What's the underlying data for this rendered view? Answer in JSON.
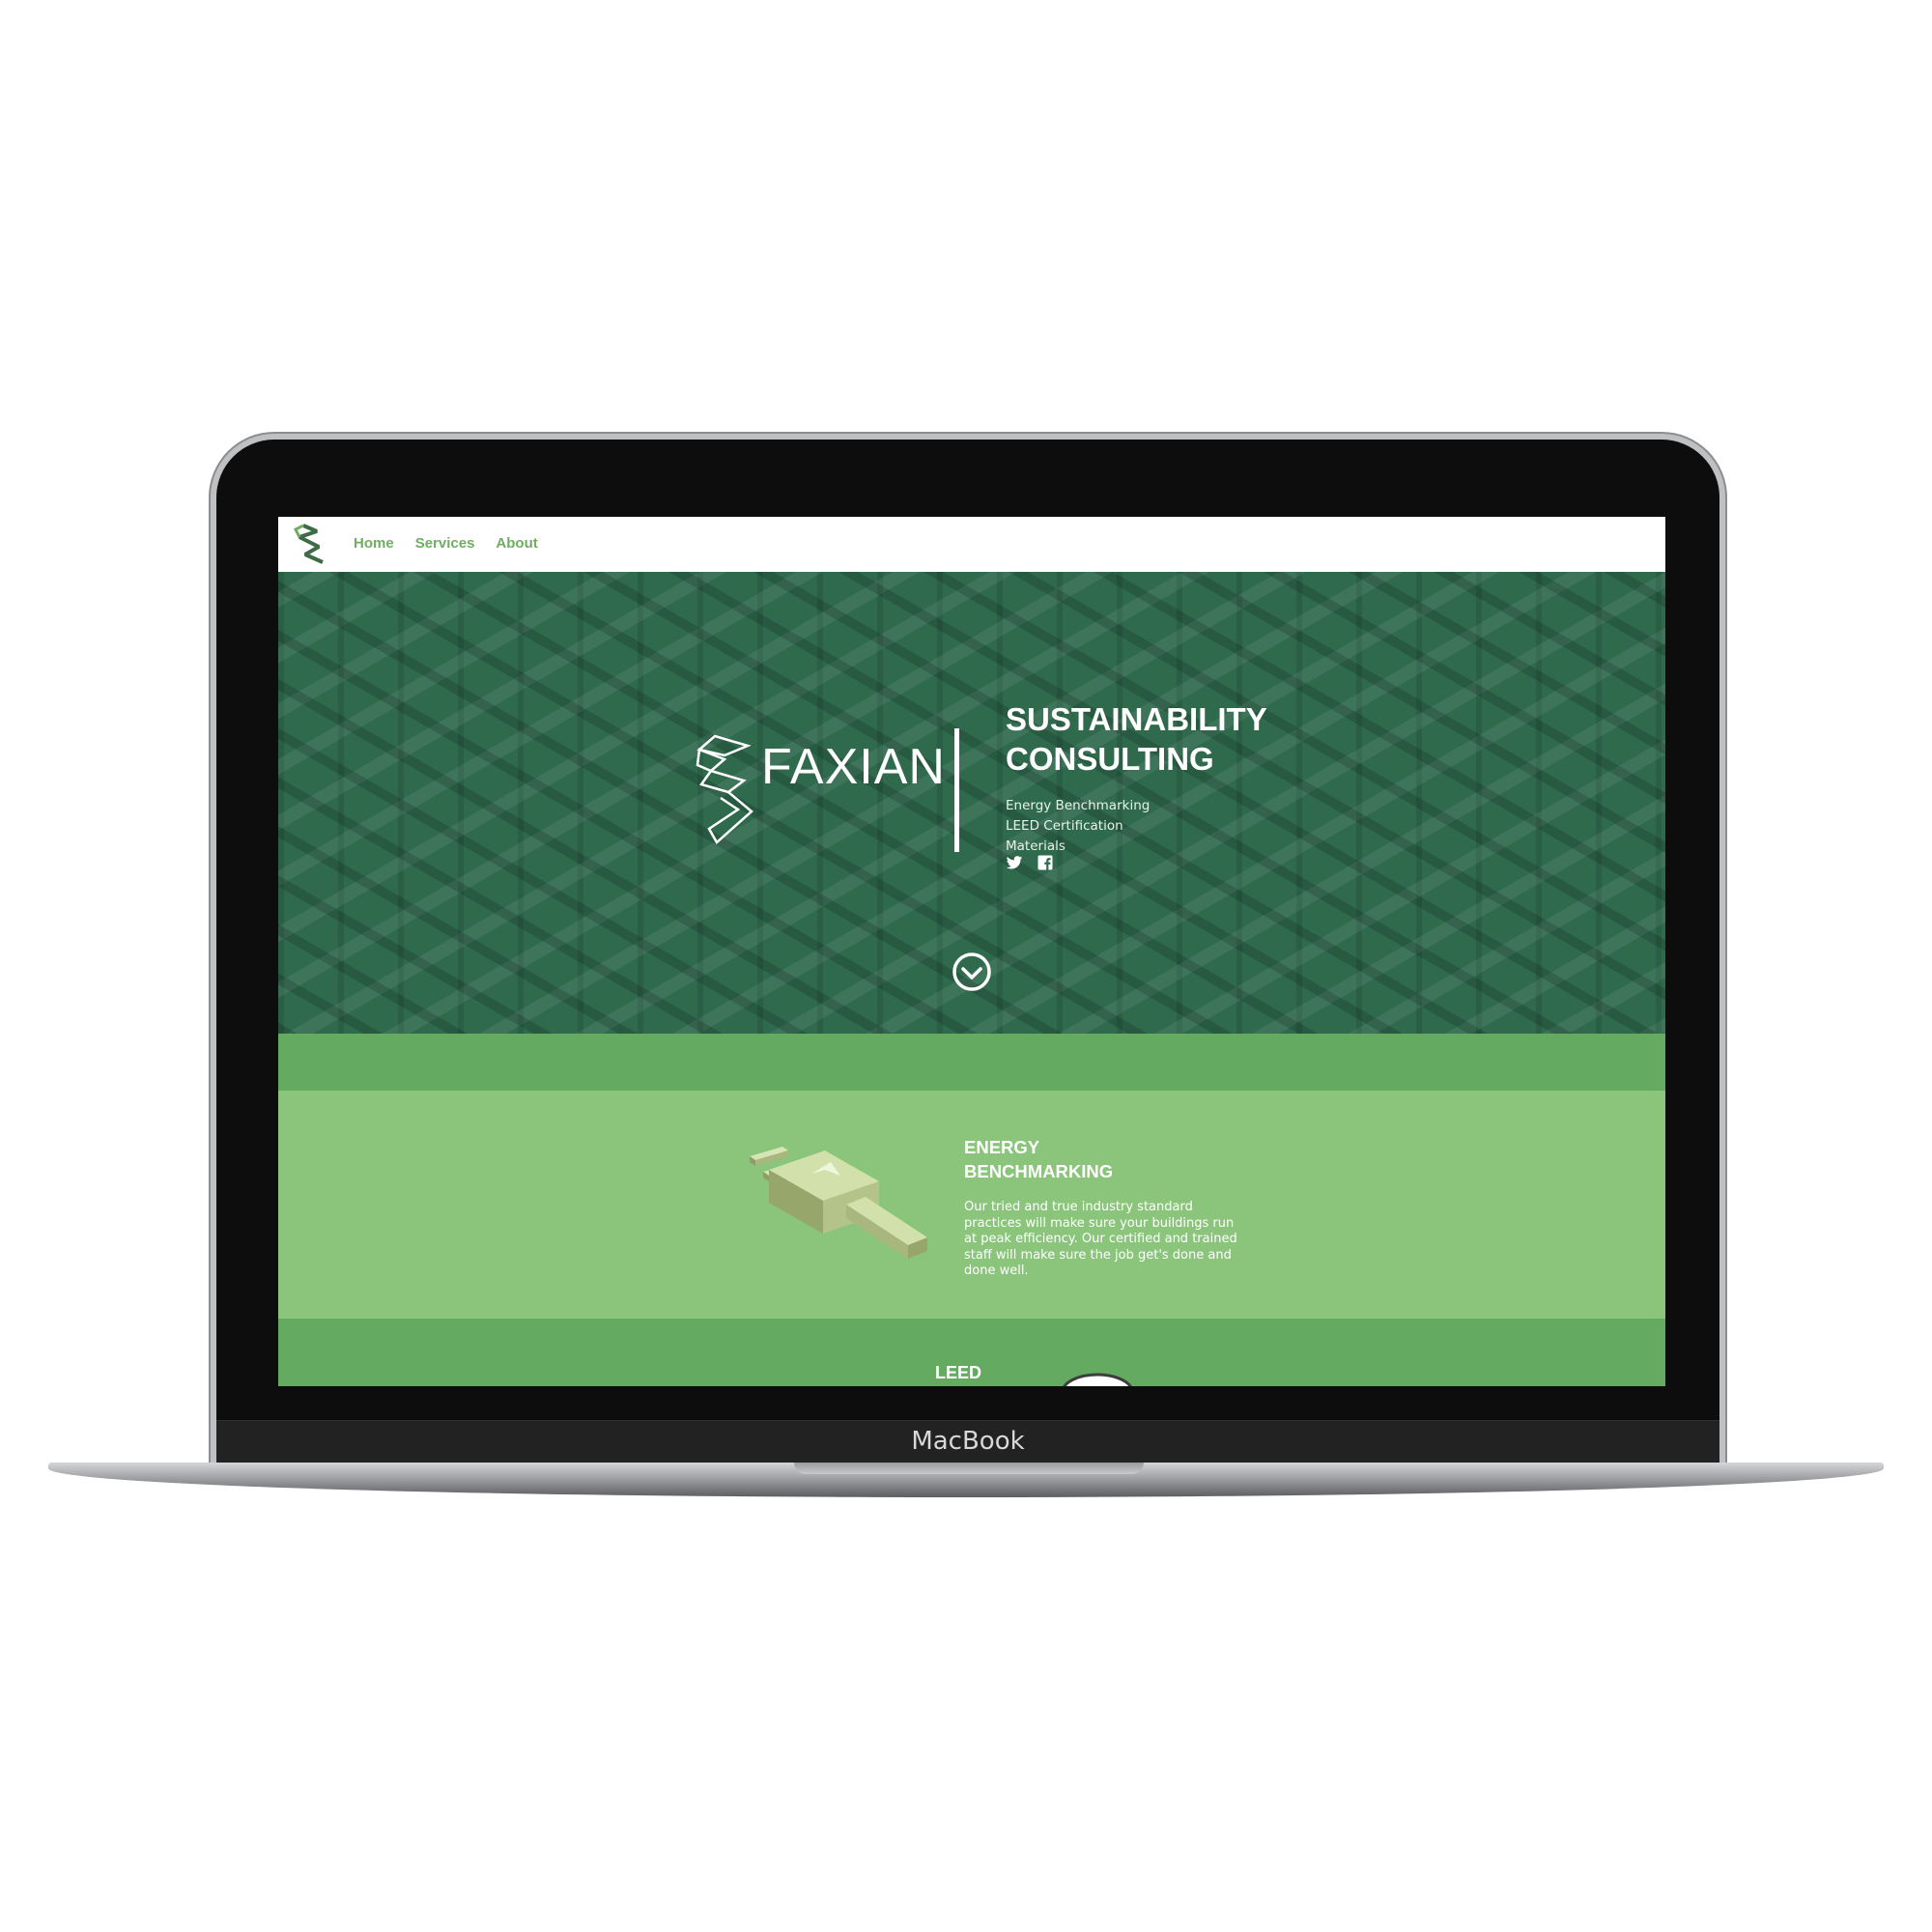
{
  "device": {
    "brand_label": "MacBook"
  },
  "nav": {
    "items": [
      "Home",
      "Services",
      "About"
    ]
  },
  "hero": {
    "wordmark": "FAXIAN",
    "title_line1": "SUSTAINABILITY",
    "title_line2": "CONSULTING",
    "services": [
      "Energy Benchmarking",
      "LEED Certification",
      "Materials"
    ],
    "social_icons": [
      "twitter-icon",
      "facebook-icon"
    ],
    "scroll_icon": "chevron-down-circle-icon"
  },
  "energy": {
    "title_line1": "ENERGY",
    "title_line2": "BENCHMARKING",
    "description": "Our tried and true industry standard practices will make sure your buildings run at peak efficiency. Our certified and trained staff will make sure the job get's done and done well.",
    "icon": "power-plug-icon"
  },
  "leed": {
    "title": "LEED"
  },
  "colors": {
    "hero_bg": "#2f6a4d",
    "band_dark": "#64aa61",
    "band_light": "#8ac57b",
    "nav_link": "#6fae62",
    "bezel": "#0d0d0d"
  }
}
